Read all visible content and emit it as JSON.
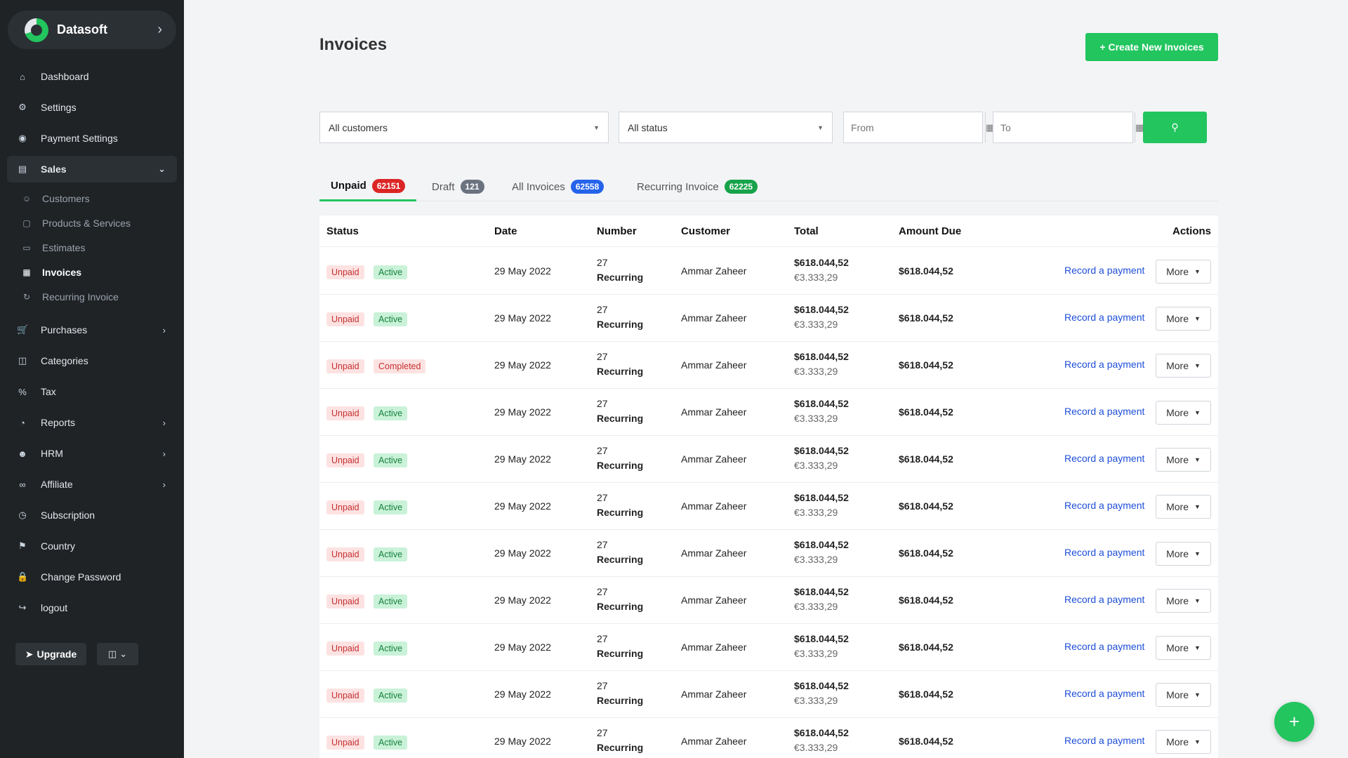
{
  "brand": {
    "name": "Datasoft",
    "chevron_icon": "chevron-right-icon"
  },
  "sidebar": {
    "items": [
      {
        "label": "Dashboard",
        "icon": "home-icon"
      },
      {
        "label": "Settings",
        "icon": "gear-icon"
      },
      {
        "label": "Payment Settings",
        "icon": "dollar-circle-icon"
      },
      {
        "label": "Sales",
        "icon": "card-icon",
        "expanded": true
      },
      {
        "label": "Purchases",
        "icon": "cart-icon",
        "has_children": true
      },
      {
        "label": "Categories",
        "icon": "folder-icon"
      },
      {
        "label": "Tax",
        "icon": "percent-icon"
      },
      {
        "label": "Reports",
        "icon": "pie-chart-icon",
        "has_children": true
      },
      {
        "label": "HRM",
        "icon": "user-icon",
        "has_children": true
      },
      {
        "label": "Affiliate",
        "icon": "link-icon",
        "has_children": true
      },
      {
        "label": "Subscription",
        "icon": "clock-icon"
      },
      {
        "label": "Country",
        "icon": "flag-icon"
      },
      {
        "label": "Change Password",
        "icon": "lock-icon"
      },
      {
        "label": "logout",
        "icon": "logout-icon"
      }
    ],
    "sales_sub": [
      {
        "label": "Customers",
        "icon": "users-icon"
      },
      {
        "label": "Products & Services",
        "icon": "box-icon"
      },
      {
        "label": "Estimates",
        "icon": "document-icon"
      },
      {
        "label": "Invoices",
        "icon": "invoice-icon",
        "active": true
      },
      {
        "label": "Recurring Invoice",
        "icon": "recurring-icon"
      }
    ],
    "upgrade_label": "Upgrade"
  },
  "header": {
    "title": "Invoices",
    "create_label": "Create New Invoices"
  },
  "filters": {
    "customer_select": "All customers",
    "status_select": "All status",
    "from_placeholder": "From",
    "to_placeholder": "To"
  },
  "tabs": [
    {
      "label": "Unpaid",
      "count": "62151",
      "color": "#dc2626",
      "active": true
    },
    {
      "label": "Draft",
      "count": "121",
      "color": "#6b7280"
    },
    {
      "label": "All Invoices",
      "count": "62558",
      "color": "#2563eb"
    },
    {
      "label": "Recurring Invoice",
      "count": "62225",
      "color": "#16a34a"
    }
  ],
  "table": {
    "columns": [
      "Status",
      "Date",
      "Number",
      "Customer",
      "Total",
      "Amount Due",
      "Actions"
    ],
    "rows": [
      {
        "status": "Unpaid",
        "state": "Active",
        "date": "29 May 2022",
        "number": "27",
        "type": "Recurring",
        "customer": "Ammar Zaheer",
        "total": "$618.044,52",
        "total_alt": "€3.333,29",
        "amount_due": "$618.044,52"
      },
      {
        "status": "Unpaid",
        "state": "Active",
        "date": "29 May 2022",
        "number": "27",
        "type": "Recurring",
        "customer": "Ammar Zaheer",
        "total": "$618.044,52",
        "total_alt": "€3.333,29",
        "amount_due": "$618.044,52"
      },
      {
        "status": "Unpaid",
        "state": "Completed",
        "date": "29 May 2022",
        "number": "27",
        "type": "Recurring",
        "customer": "Ammar Zaheer",
        "total": "$618.044,52",
        "total_alt": "€3.333,29",
        "amount_due": "$618.044,52"
      },
      {
        "status": "Unpaid",
        "state": "Active",
        "date": "29 May 2022",
        "number": "27",
        "type": "Recurring",
        "customer": "Ammar Zaheer",
        "total": "$618.044,52",
        "total_alt": "€3.333,29",
        "amount_due": "$618.044,52"
      },
      {
        "status": "Unpaid",
        "state": "Active",
        "date": "29 May 2022",
        "number": "27",
        "type": "Recurring",
        "customer": "Ammar Zaheer",
        "total": "$618.044,52",
        "total_alt": "€3.333,29",
        "amount_due": "$618.044,52"
      },
      {
        "status": "Unpaid",
        "state": "Active",
        "date": "29 May 2022",
        "number": "27",
        "type": "Recurring",
        "customer": "Ammar Zaheer",
        "total": "$618.044,52",
        "total_alt": "€3.333,29",
        "amount_due": "$618.044,52"
      },
      {
        "status": "Unpaid",
        "state": "Active",
        "date": "29 May 2022",
        "number": "27",
        "type": "Recurring",
        "customer": "Ammar Zaheer",
        "total": "$618.044,52",
        "total_alt": "€3.333,29",
        "amount_due": "$618.044,52"
      },
      {
        "status": "Unpaid",
        "state": "Active",
        "date": "29 May 2022",
        "number": "27",
        "type": "Recurring",
        "customer": "Ammar Zaheer",
        "total": "$618.044,52",
        "total_alt": "€3.333,29",
        "amount_due": "$618.044,52"
      },
      {
        "status": "Unpaid",
        "state": "Active",
        "date": "29 May 2022",
        "number": "27",
        "type": "Recurring",
        "customer": "Ammar Zaheer",
        "total": "$618.044,52",
        "total_alt": "€3.333,29",
        "amount_due": "$618.044,52"
      },
      {
        "status": "Unpaid",
        "state": "Active",
        "date": "29 May 2022",
        "number": "27",
        "type": "Recurring",
        "customer": "Ammar Zaheer",
        "total": "$618.044,52",
        "total_alt": "€3.333,29",
        "amount_due": "$618.044,52"
      },
      {
        "status": "Unpaid",
        "state": "Active",
        "date": "29 May 2022",
        "number": "27",
        "type": "Recurring",
        "customer": "Ammar Zaheer",
        "total": "$618.044,52",
        "total_alt": "€3.333,29",
        "amount_due": "$618.044,52"
      }
    ],
    "record_label": "Record a payment",
    "more_label": "More"
  },
  "colors": {
    "accent": "#22c55e",
    "sidebar_bg": "#1f2326",
    "link": "#1d4ed8"
  }
}
